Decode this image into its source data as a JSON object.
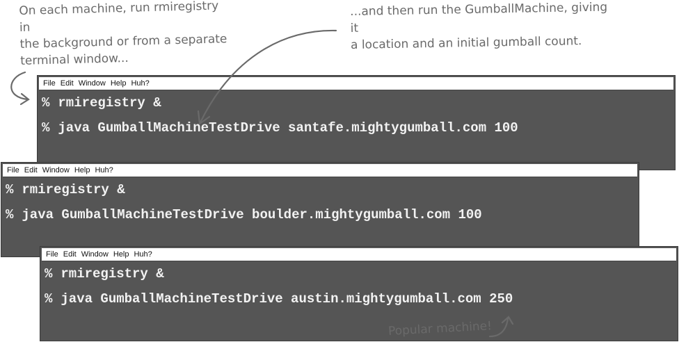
{
  "annotations": {
    "left": "On each machine, run rmiregistry in\nthe background or from a separate\nterminal window...",
    "right": "...and then run the GumballMachine, giving it\na location and an initial gumball count.",
    "popular": "Popular machine!"
  },
  "menu": [
    "File",
    "Edit",
    "Window",
    "Help",
    "Huh?"
  ],
  "prompt_symbol": "%",
  "terminals": [
    {
      "lines": [
        "rmiregistry &",
        "java GumballMachineTestDrive santafe.mightygumball.com 100"
      ]
    },
    {
      "lines": [
        "rmiregistry &",
        "java GumballMachineTestDrive boulder.mightygumball.com 100"
      ]
    },
    {
      "lines": [
        "rmiregistry &",
        "java GumballMachineTestDrive austin.mightygumball.com 250"
      ]
    }
  ],
  "colors": {
    "terminal_bg": "#555555",
    "terminal_text": "#f2f2f2",
    "annotation": "#6a6a6a"
  }
}
